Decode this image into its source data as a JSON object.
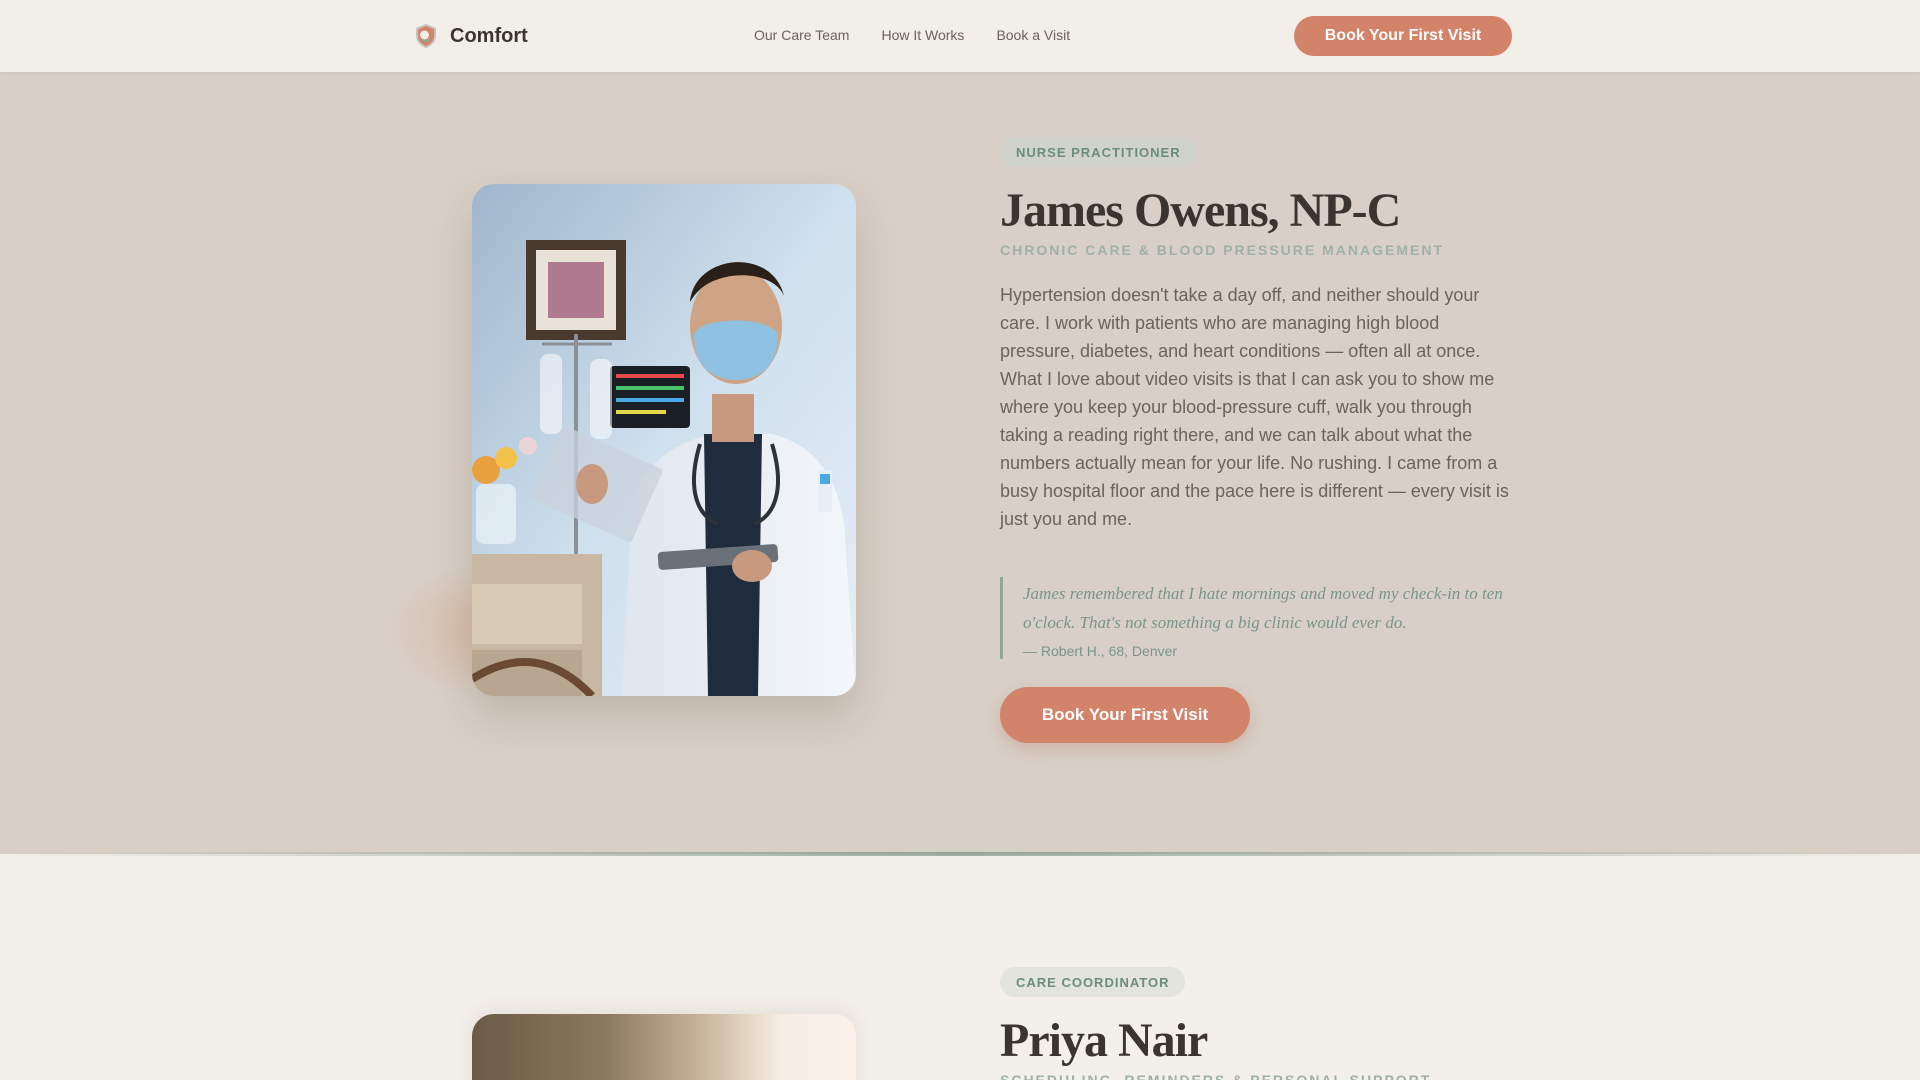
{
  "header": {
    "brand_name": "Comfort",
    "nav": [
      "Our Care Team",
      "How It Works",
      "Book a Visit"
    ],
    "cta_label": "Book Your First Visit"
  },
  "profile1": {
    "badge": "NURSE PRACTITIONER",
    "name": "James Owens, NP-C",
    "specialty": "CHRONIC CARE & BLOOD PRESSURE MANAGEMENT",
    "bio": "Hypertension doesn't take a day off, and neither should your care. I work with patients who are managing high blood pressure, diabetes, and heart conditions — often all at once. What I love about video visits is that I can ask you to show me where you keep your blood-pressure cuff, walk you through taking a reading right there, and we can talk about what the numbers actually mean for your life. No rushing. I came from a busy hospital floor and the pace here is different — every visit is just you and me.",
    "quote": "James remembered that I hate mornings and moved my check-in to ten o'clock. That's not something a big clinic would ever do.",
    "quote_author": "— Robert H., 68, Denver",
    "cta_label": "Book Your First Visit"
  },
  "profile2": {
    "badge": "CARE COORDINATOR",
    "name": "Priya Nair",
    "specialty": "SCHEDULING, REMINDERS & PERSONAL SUPPORT"
  },
  "colors": {
    "accent": "#d2836a",
    "section_bg": "#d8cfc6",
    "page_bg": "#f3efe9",
    "sage": "#7a9588"
  }
}
